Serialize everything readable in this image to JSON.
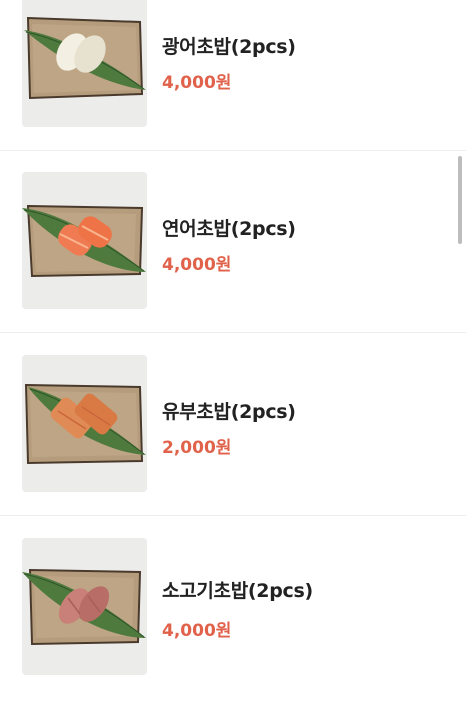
{
  "menu": {
    "items": [
      {
        "name": "광어초밥(2pcs)",
        "price": "4,000원",
        "sushi_color": "#f3efe2",
        "sushi_accent": "#e7e1cf"
      },
      {
        "name": "연어초밥(2pcs)",
        "price": "4,000원",
        "sushi_color": "#f07a52",
        "sushi_accent": "#f9b58f"
      },
      {
        "name": "유부초밥(2pcs)",
        "price": "2,000원",
        "sushi_color": "#e08a55",
        "sushi_accent": "#c9663a"
      },
      {
        "name": "소고기초밥(2pcs)",
        "price": "4,000원",
        "sushi_color": "#c98078",
        "sushi_accent": "#a85f58"
      }
    ]
  },
  "colors": {
    "price": "#e1624b",
    "name": "#222222",
    "plate": "#b59c7c",
    "plate_edge": "#4a3a2c",
    "leaf": "#4f7a3e"
  }
}
